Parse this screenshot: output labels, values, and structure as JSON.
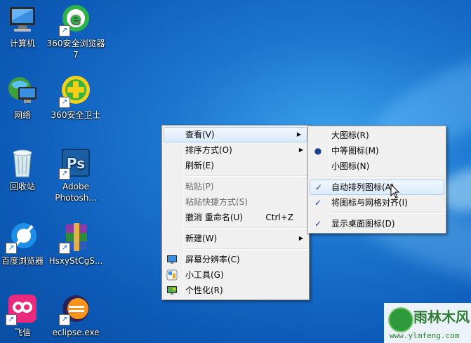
{
  "desktop": {
    "icons": [
      {
        "label": "计算机",
        "icon": "computer-icon",
        "shortcut": false
      },
      {
        "label": "360安全浏览器7",
        "icon": "360-browser-icon",
        "shortcut": true
      },
      {
        "label": "网络",
        "icon": "network-icon",
        "shortcut": false
      },
      {
        "label": "360安全卫士",
        "icon": "360-safe-icon",
        "shortcut": true
      },
      {
        "label": "回收站",
        "icon": "recycle-bin-icon",
        "shortcut": false
      },
      {
        "label": "Adobe Photosh...",
        "icon": "photoshop-icon",
        "shortcut": true
      },
      {
        "label": "百度浏览器",
        "icon": "baidu-browser-icon",
        "shortcut": true
      },
      {
        "label": "HsxyStCgS...",
        "icon": "winrar-archive-icon",
        "shortcut": true
      },
      {
        "label": "飞信",
        "icon": "fetion-icon",
        "shortcut": true
      },
      {
        "label": "eclipse.exe",
        "icon": "eclipse-icon",
        "shortcut": true
      }
    ]
  },
  "context_menu": {
    "items": [
      {
        "label": "查看(V)",
        "submenu": true,
        "highlighted": true
      },
      {
        "label": "排序方式(O)",
        "submenu": true
      },
      {
        "label": "刷新(E)"
      },
      {
        "label": "粘贴(P)",
        "disabled": true
      },
      {
        "label": "粘贴快捷方式(S)",
        "disabled": true
      },
      {
        "label": "撤消 重命名(U)",
        "accel": "Ctrl+Z"
      },
      {
        "label": "新建(W)",
        "submenu": true
      },
      {
        "label": "屏幕分辨率(C)",
        "icon": "display-icon"
      },
      {
        "label": "小工具(G)",
        "icon": "gadgets-icon"
      },
      {
        "label": "个性化(R)",
        "icon": "personalize-icon"
      }
    ]
  },
  "view_submenu": {
    "items": [
      {
        "label": "大图标(R)"
      },
      {
        "label": "中等图标(M)",
        "mark": "●"
      },
      {
        "label": "小图标(N)"
      },
      {
        "label": "自动排列图标(A)",
        "mark": "✓",
        "highlighted": true
      },
      {
        "label": "将图标与网格对齐(I)",
        "mark": "✓"
      },
      {
        "label": "显示桌面图标(D)",
        "mark": "✓"
      }
    ]
  },
  "watermark": {
    "title": "雨林木风",
    "url": "www.ylmfeng.com"
  }
}
